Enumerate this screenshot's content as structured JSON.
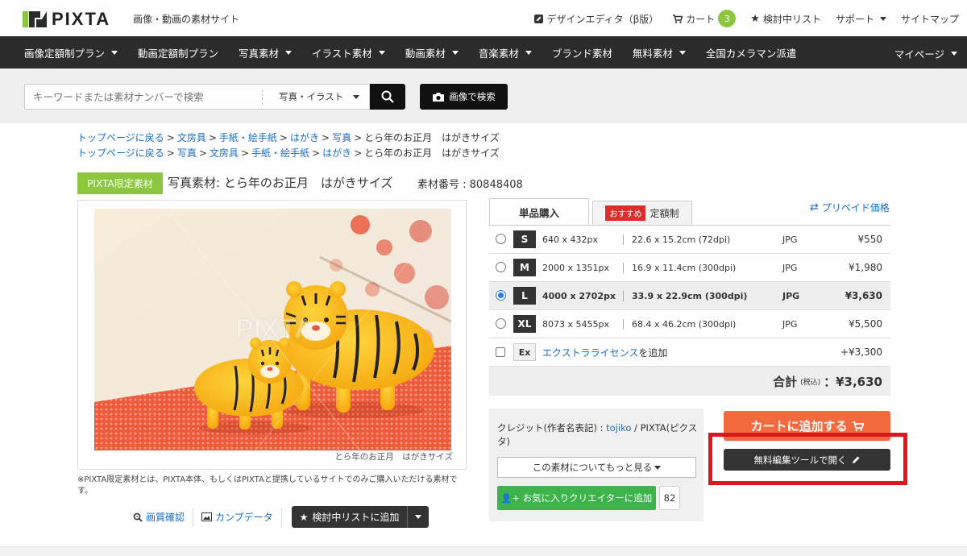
{
  "header": {
    "logo_text": "PIXTA",
    "tagline": "画像・動画の素材サイト",
    "nav": {
      "design_editor": "デザインエディタ（β版）",
      "cart": "カート",
      "cart_count": "3",
      "wishlist": "検討中リスト",
      "support": "サポート",
      "sitemap": "サイトマップ"
    }
  },
  "category_nav": {
    "items": [
      {
        "label": "画像定額制プラン",
        "dropdown": true
      },
      {
        "label": "動画定額制プラン",
        "dropdown": false
      },
      {
        "label": "写真素材",
        "dropdown": true
      },
      {
        "label": "イラスト素材",
        "dropdown": true
      },
      {
        "label": "動画素材",
        "dropdown": true
      },
      {
        "label": "音楽素材",
        "dropdown": true
      },
      {
        "label": "ブランド素材",
        "dropdown": false
      },
      {
        "label": "無料素材",
        "dropdown": true
      },
      {
        "label": "全国カメラマン派遣",
        "dropdown": false
      }
    ],
    "mypage": "マイページ"
  },
  "search": {
    "placeholder": "キーワードまたは素材ナンバーで検索",
    "type_selected": "写真・イラスト",
    "image_search_label": "画像で検索"
  },
  "breadcrumbs": [
    [
      "トップページに戻る",
      "文房具",
      "手紙・絵手紙",
      "はがき",
      "写真",
      "とら年のお正月　はがきサイズ"
    ],
    [
      "トップページに戻る",
      "写真",
      "文房具",
      "手紙・絵手紙",
      "はがき",
      "とら年のお正月　はがきサイズ"
    ]
  ],
  "product": {
    "exclusive_badge": "PIXTA限定素材",
    "title": "写真素材: とら年のお正月　はがきサイズ",
    "number": "素材番号 : 80848408",
    "caption": "とら年のお正月　はがきサイズ",
    "watermark": "PIXTA",
    "note": "※PIXTA限定素材とは、PIXTA本体、もしくはPIXTAと提携しているサイトでのみご購入いただける素材です。",
    "tools": {
      "quality_check": "画質確認",
      "comp_data": "カンプデータ",
      "add_wishlist": "検討中リストに追加"
    }
  },
  "purchase": {
    "tab_single": "単品購入",
    "tab_recommend_badge": "おすすめ",
    "tab_subscription": "定額制",
    "prepaid_link": "プリペイド価格",
    "sizes": [
      {
        "size": "S",
        "px": "640 x 432px",
        "cm": "22.6 x 15.2cm (72dpi)",
        "format": "JPG",
        "price": "¥550",
        "selected": false
      },
      {
        "size": "M",
        "px": "2000 x 1351px",
        "cm": "16.9 x 11.4cm (300dpi)",
        "format": "JPG",
        "price": "¥1,980",
        "selected": false
      },
      {
        "size": "L",
        "px": "4000 x 2702px",
        "cm": "33.9 x 22.9cm (300dpi)",
        "format": "JPG",
        "price": "¥3,630",
        "selected": true
      },
      {
        "size": "XL",
        "px": "8073 x 5455px",
        "cm": "68.4 x 46.2cm (300dpi)",
        "format": "JPG",
        "price": "¥5,500",
        "selected": false
      }
    ],
    "extra": {
      "badge": "Ex",
      "link": "エクストラライセンス",
      "suffix": "を追加",
      "price": "+¥3,300"
    },
    "total_label": "合計",
    "total_tax": "(税込)",
    "total_value": "：¥3,630",
    "credit_label": "クレジット(作者名表記) : ",
    "credit_author": "tojiko",
    "credit_suffix": " / PIXTA(ピクスタ)",
    "more_about": "この素材についてもっと見る",
    "fav_creator": "お気に入りクリエイターに追加",
    "fav_count": "82",
    "add_to_cart": "カートに追加する",
    "open_editor": "無料編集ツールで開く"
  },
  "colors": {
    "brand_green": "#8cc63f",
    "cart_orange": "#f26a3d",
    "highlight_red": "#e0161b",
    "link_blue": "#1a6fc4"
  }
}
